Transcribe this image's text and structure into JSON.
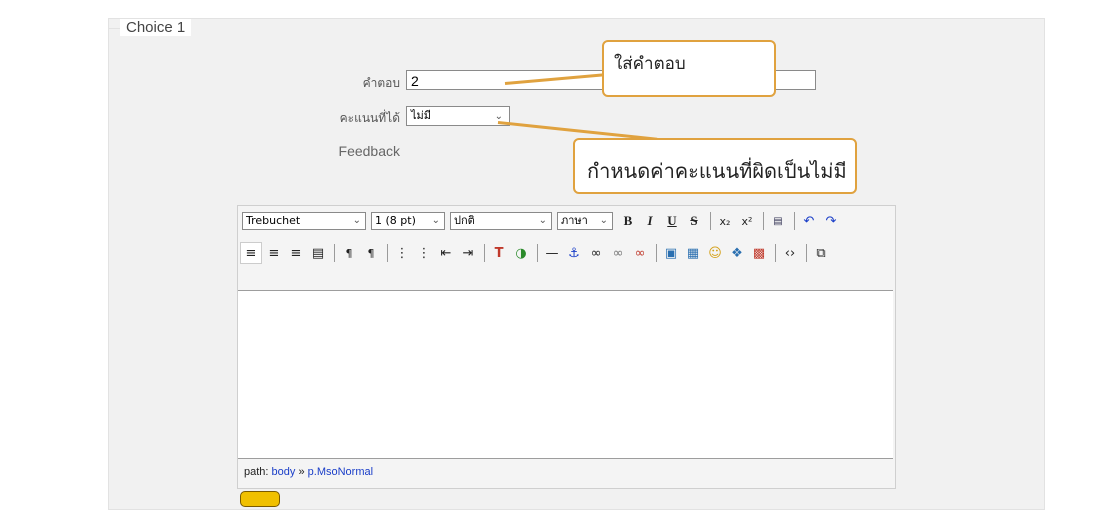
{
  "section": {
    "legend": "Choice 1"
  },
  "fields": {
    "answer_label": "คำตอบ",
    "answer_value": "2",
    "grade_label": "คะแนนที่ได้",
    "grade_value": "ไม่มี",
    "feedback_label": "Feedback"
  },
  "callouts": {
    "answer_note": "ใส่คำตอบ",
    "grade_note": "กำหนดค่าคะแนนที่ผิดเป็นไม่มี"
  },
  "editor": {
    "font_family": "Trebuchet",
    "font_size": "1 (8 pt)",
    "format": "ปกติ",
    "language": "ภาษา",
    "toolbar_row1": [
      "bold-icon",
      "italic-icon",
      "underline-icon",
      "strikethrough-icon",
      "subscript-icon",
      "superscript-icon",
      "paste-word-icon",
      "undo-icon",
      "redo-icon"
    ],
    "toolbar_row2": [
      "align-left-icon",
      "align-center-icon",
      "align-right-icon",
      "justify-icon",
      "ltr-icon",
      "rtl-icon",
      "ordered-list-icon",
      "unordered-list-icon",
      "outdent-icon",
      "indent-icon",
      "text-color-icon",
      "background-color-icon",
      "horizontal-rule-icon",
      "anchor-icon",
      "link-icon",
      "unlink-icon",
      "nolink-icon",
      "insert-image-icon",
      "insert-table-icon",
      "smiley-icon",
      "special-char-icon",
      "spellcheck-icon",
      "html-source-icon",
      "fullscreen-icon"
    ],
    "path_label": "path:",
    "path_body": "body",
    "path_sep": "»",
    "path_p": "p.MsoNormal"
  },
  "colors": {
    "callout_border": "#e0a23f",
    "link": "#1a3ec8",
    "panel_bg": "#f1f1f1"
  }
}
